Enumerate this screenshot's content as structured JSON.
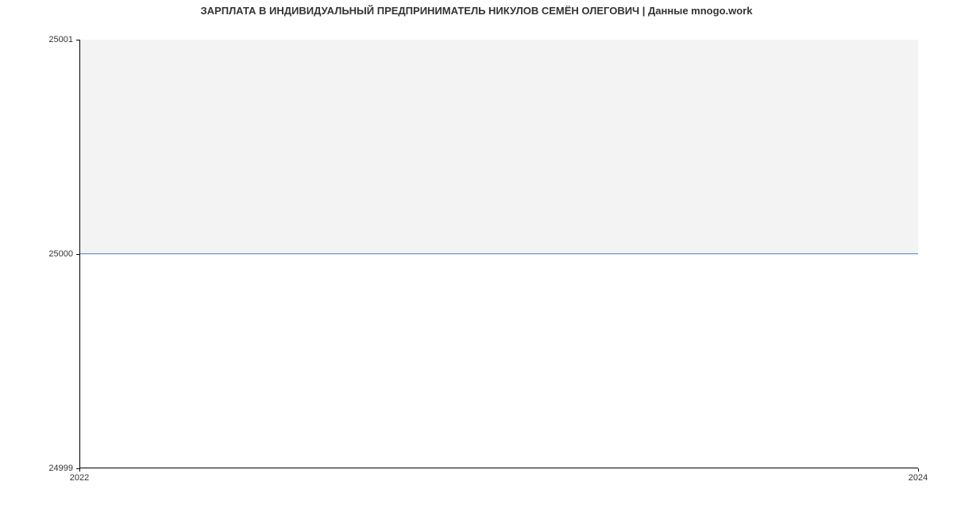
{
  "chart_data": {
    "type": "area",
    "title": "ЗАРПЛАТА В ИНДИВИДУАЛЬНЫЙ ПРЕДПРИНИМАТЕЛЬ НИКУЛОВ СЕМЁН ОЛЕГОВИЧ | Данные mnogo.work",
    "xlabel": "",
    "ylabel": "",
    "x": [
      2022,
      2024
    ],
    "values": [
      25000,
      25000
    ],
    "xlim": [
      2022,
      2024
    ],
    "ylim": [
      24999,
      25001
    ],
    "x_ticks": [
      "2022",
      "2024"
    ],
    "y_ticks": [
      "24999",
      "25000",
      "25001"
    ],
    "line_color": "#4a7fd4",
    "fill_color": "#f3f3f3"
  }
}
